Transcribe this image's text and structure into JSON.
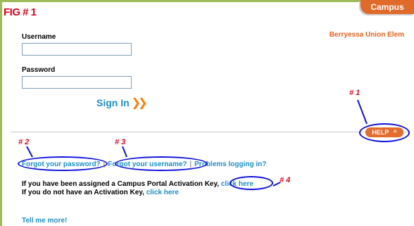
{
  "header": {
    "fig_label": "FIG # 1",
    "portal_title": "Campus Portal",
    "district": "Berryessa Union Elem"
  },
  "login": {
    "username_label": "Username",
    "username_value": "",
    "password_label": "Password",
    "password_value": "",
    "signin_label": "Sign In",
    "signin_chevron": "❯❯"
  },
  "help": {
    "label": "HELP",
    "caret": "^"
  },
  "annotations": {
    "a1": "# 1",
    "a2": "# 2",
    "a3": "# 3",
    "a4": "# 4"
  },
  "links": {
    "forgot_password": "Forgot your password?",
    "separator": "|",
    "forgot_username": "Forgot your username?",
    "problems": "Problems logging in?"
  },
  "activation": {
    "line1_text": "If you have been assigned a Campus Portal Activation Key,",
    "line1_link": "click here",
    "line2_text": "If you do not have an Activation Key,",
    "line2_link": "click here"
  },
  "footer": {
    "tell_more": "Tell me more!"
  },
  "colors": {
    "accent_orange": "#e36b2c",
    "link_blue": "#1e8fc6",
    "annotation_red": "#e0001b",
    "annotation_circle": "#1010e0"
  }
}
